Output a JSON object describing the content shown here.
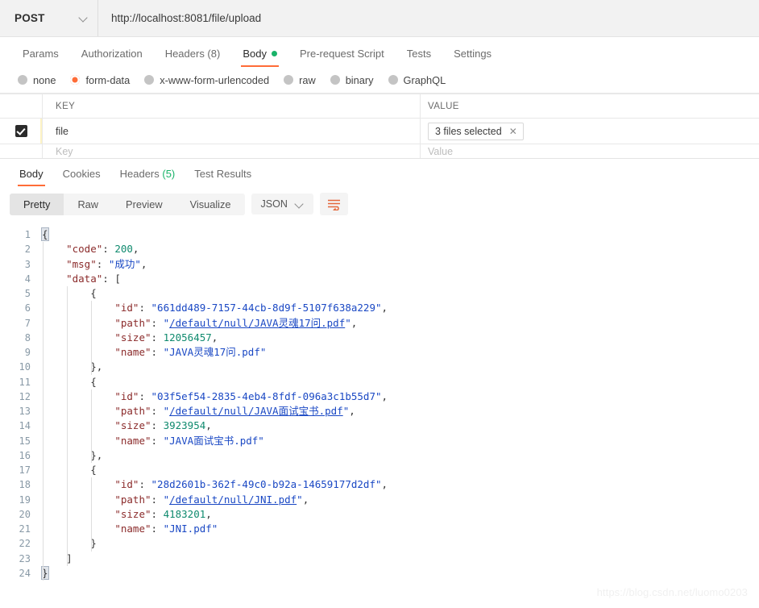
{
  "request": {
    "method": "POST",
    "url": "http://localhost:8081/file/upload",
    "tabs": [
      {
        "label": "Params",
        "active": false
      },
      {
        "label": "Authorization",
        "active": false
      },
      {
        "label": "Headers (8)",
        "active": false
      },
      {
        "label": "Body",
        "active": true,
        "dot": "green"
      },
      {
        "label": "Pre-request Script",
        "active": false
      },
      {
        "label": "Tests",
        "active": false
      },
      {
        "label": "Settings",
        "active": false
      }
    ],
    "body_types": [
      {
        "label": "none",
        "selected": false
      },
      {
        "label": "form-data",
        "selected": true
      },
      {
        "label": "x-www-form-urlencoded",
        "selected": false
      },
      {
        "label": "raw",
        "selected": false
      },
      {
        "label": "binary",
        "selected": false
      },
      {
        "label": "GraphQL",
        "selected": false
      }
    ],
    "table": {
      "columns": {
        "key": "KEY",
        "value": "VALUE"
      },
      "rows": [
        {
          "checked": true,
          "key": "file",
          "value_chip": "3 files selected",
          "chip_close": "✕"
        }
      ],
      "placeholder_row": {
        "key": "",
        "value": ""
      }
    }
  },
  "response": {
    "tabs": [
      {
        "label": "Body",
        "active": true
      },
      {
        "label": "Cookies",
        "active": false
      },
      {
        "label": "Headers",
        "count": "(5)",
        "active": false
      },
      {
        "label": "Test Results",
        "active": false
      }
    ],
    "view_modes": [
      {
        "label": "Pretty",
        "active": true
      },
      {
        "label": "Raw",
        "active": false
      },
      {
        "label": "Preview",
        "active": false
      },
      {
        "label": "Visualize",
        "active": false
      }
    ],
    "language": "JSON",
    "wrap_icon": "word-wrap-icon",
    "body_json": {
      "code": 200,
      "msg": "成功",
      "data": [
        {
          "id": "661dd489-7157-44cb-8d9f-5107f638a229",
          "path": "/default/null/JAVA灵魂17问.pdf",
          "size": 12056457,
          "name": "JAVA灵魂17问.pdf"
        },
        {
          "id": "03f5ef54-2835-4eb4-8fdf-096a3c1b55d7",
          "path": "/default/null/JAVA面试宝书.pdf",
          "size": 3923954,
          "name": "JAVA面试宝书.pdf"
        },
        {
          "id": "28d2601b-362f-49c0-b92a-14659177d2df",
          "path": "/default/null/JNI.pdf",
          "size": 4183201,
          "name": "JNI.pdf"
        }
      ]
    },
    "code_lines": [
      {
        "n": "1",
        "indent": 0,
        "tokens": [
          {
            "t": "{",
            "c": "p hl"
          }
        ]
      },
      {
        "n": "2",
        "indent": 1,
        "tokens": [
          {
            "t": "\"code\"",
            "c": "k"
          },
          {
            "t": ": ",
            "c": "p"
          },
          {
            "t": "200",
            "c": "n"
          },
          {
            "t": ",",
            "c": "p"
          }
        ]
      },
      {
        "n": "3",
        "indent": 1,
        "tokens": [
          {
            "t": "\"msg\"",
            "c": "k"
          },
          {
            "t": ": ",
            "c": "p"
          },
          {
            "t": "\"成功\"",
            "c": "s"
          },
          {
            "t": ",",
            "c": "p"
          }
        ]
      },
      {
        "n": "4",
        "indent": 1,
        "tokens": [
          {
            "t": "\"data\"",
            "c": "k"
          },
          {
            "t": ": ",
            "c": "p"
          },
          {
            "t": "[",
            "c": "p"
          }
        ]
      },
      {
        "n": "5",
        "indent": 2,
        "tokens": [
          {
            "t": "{",
            "c": "p"
          }
        ]
      },
      {
        "n": "6",
        "indent": 3,
        "tokens": [
          {
            "t": "\"id\"",
            "c": "k"
          },
          {
            "t": ": ",
            "c": "p"
          },
          {
            "t": "\"661dd489-7157-44cb-8d9f-5107f638a229\"",
            "c": "s"
          },
          {
            "t": ",",
            "c": "p"
          }
        ]
      },
      {
        "n": "7",
        "indent": 3,
        "tokens": [
          {
            "t": "\"path\"",
            "c": "k"
          },
          {
            "t": ": ",
            "c": "p"
          },
          {
            "t": "\"",
            "c": "s"
          },
          {
            "t": "/default/null/JAVA灵魂17问.pdf",
            "c": "lnk"
          },
          {
            "t": "\"",
            "c": "s"
          },
          {
            "t": ",",
            "c": "p"
          }
        ]
      },
      {
        "n": "8",
        "indent": 3,
        "tokens": [
          {
            "t": "\"size\"",
            "c": "k"
          },
          {
            "t": ": ",
            "c": "p"
          },
          {
            "t": "12056457",
            "c": "n"
          },
          {
            "t": ",",
            "c": "p"
          }
        ]
      },
      {
        "n": "9",
        "indent": 3,
        "tokens": [
          {
            "t": "\"name\"",
            "c": "k"
          },
          {
            "t": ": ",
            "c": "p"
          },
          {
            "t": "\"JAVA灵魂17问.pdf\"",
            "c": "s"
          }
        ]
      },
      {
        "n": "10",
        "indent": 2,
        "tokens": [
          {
            "t": "},",
            "c": "p"
          }
        ]
      },
      {
        "n": "11",
        "indent": 2,
        "tokens": [
          {
            "t": "{",
            "c": "p"
          }
        ]
      },
      {
        "n": "12",
        "indent": 3,
        "tokens": [
          {
            "t": "\"id\"",
            "c": "k"
          },
          {
            "t": ": ",
            "c": "p"
          },
          {
            "t": "\"03f5ef54-2835-4eb4-8fdf-096a3c1b55d7\"",
            "c": "s"
          },
          {
            "t": ",",
            "c": "p"
          }
        ]
      },
      {
        "n": "13",
        "indent": 3,
        "tokens": [
          {
            "t": "\"path\"",
            "c": "k"
          },
          {
            "t": ": ",
            "c": "p"
          },
          {
            "t": "\"",
            "c": "s"
          },
          {
            "t": "/default/null/JAVA面试宝书.pdf",
            "c": "lnk"
          },
          {
            "t": "\"",
            "c": "s"
          },
          {
            "t": ",",
            "c": "p"
          }
        ]
      },
      {
        "n": "14",
        "indent": 3,
        "tokens": [
          {
            "t": "\"size\"",
            "c": "k"
          },
          {
            "t": ": ",
            "c": "p"
          },
          {
            "t": "3923954",
            "c": "n"
          },
          {
            "t": ",",
            "c": "p"
          }
        ]
      },
      {
        "n": "15",
        "indent": 3,
        "tokens": [
          {
            "t": "\"name\"",
            "c": "k"
          },
          {
            "t": ": ",
            "c": "p"
          },
          {
            "t": "\"JAVA面试宝书.pdf\"",
            "c": "s"
          }
        ]
      },
      {
        "n": "16",
        "indent": 2,
        "tokens": [
          {
            "t": "},",
            "c": "p"
          }
        ]
      },
      {
        "n": "17",
        "indent": 2,
        "tokens": [
          {
            "t": "{",
            "c": "p"
          }
        ]
      },
      {
        "n": "18",
        "indent": 3,
        "tokens": [
          {
            "t": "\"id\"",
            "c": "k"
          },
          {
            "t": ": ",
            "c": "p"
          },
          {
            "t": "\"28d2601b-362f-49c0-b92a-14659177d2df\"",
            "c": "s"
          },
          {
            "t": ",",
            "c": "p"
          }
        ]
      },
      {
        "n": "19",
        "indent": 3,
        "tokens": [
          {
            "t": "\"path\"",
            "c": "k"
          },
          {
            "t": ": ",
            "c": "p"
          },
          {
            "t": "\"",
            "c": "s"
          },
          {
            "t": "/default/null/JNI.pdf",
            "c": "lnk"
          },
          {
            "t": "\"",
            "c": "s"
          },
          {
            "t": ",",
            "c": "p"
          }
        ]
      },
      {
        "n": "20",
        "indent": 3,
        "tokens": [
          {
            "t": "\"size\"",
            "c": "k"
          },
          {
            "t": ": ",
            "c": "p"
          },
          {
            "t": "4183201",
            "c": "n"
          },
          {
            "t": ",",
            "c": "p"
          }
        ]
      },
      {
        "n": "21",
        "indent": 3,
        "tokens": [
          {
            "t": "\"name\"",
            "c": "k"
          },
          {
            "t": ": ",
            "c": "p"
          },
          {
            "t": "\"JNI.pdf\"",
            "c": "s"
          }
        ]
      },
      {
        "n": "22",
        "indent": 2,
        "tokens": [
          {
            "t": "}",
            "c": "p"
          }
        ]
      },
      {
        "n": "23",
        "indent": 1,
        "tokens": [
          {
            "t": "]",
            "c": "p"
          }
        ]
      },
      {
        "n": "24",
        "indent": 0,
        "tokens": [
          {
            "t": "}",
            "c": "p hl"
          }
        ]
      }
    ]
  },
  "watermark": "https://blog.csdn.net/luomo0203",
  "colors": {
    "accent": "#ff6c37",
    "success": "#19b369",
    "json_key": "#8b2b2b",
    "json_string": "#1a48c4",
    "json_number": "#0f8a6e"
  }
}
